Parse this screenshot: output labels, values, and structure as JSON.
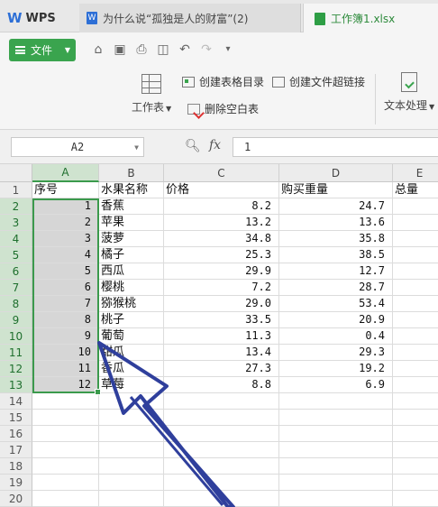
{
  "tabs": {
    "wps": "WPS",
    "doc": "为什么说“孤独是人的财富”(2)",
    "doc_badge": "W",
    "workbook": "工作簿1.xlsx"
  },
  "toolbar": {
    "file_label": "文件"
  },
  "ribbon": {
    "worksheet_label": "工作表",
    "create_toc": "创建表格目录",
    "create_hyperlink": "创建文件超链接",
    "delete_blank": "删除空白表",
    "text_process": "文本处理"
  },
  "formula_bar": {
    "name_box": "A2",
    "fx": "fx",
    "value": "1"
  },
  "columns": [
    "A",
    "B",
    "C",
    "D",
    "E"
  ],
  "rows": [
    "1",
    "2",
    "3",
    "4",
    "5",
    "6",
    "7",
    "8",
    "9",
    "10",
    "11",
    "12",
    "13",
    "14",
    "15",
    "16",
    "17",
    "18",
    "19",
    "20"
  ],
  "headers": {
    "a": "序号",
    "b": "水果名称",
    "c": "价格",
    "d": "购买重量",
    "e": "总量"
  },
  "data": [
    {
      "a": "1",
      "b": "香蕉",
      "c": "8.2",
      "d": "24.7"
    },
    {
      "a": "2",
      "b": "苹果",
      "c": "13.2",
      "d": "13.6"
    },
    {
      "a": "3",
      "b": "菠萝",
      "c": "34.8",
      "d": "35.8"
    },
    {
      "a": "4",
      "b": "橘子",
      "c": "25.3",
      "d": "38.5"
    },
    {
      "a": "5",
      "b": "西瓜",
      "c": "29.9",
      "d": "12.7"
    },
    {
      "a": "6",
      "b": "樱桃",
      "c": "7.2",
      "d": "28.7"
    },
    {
      "a": "7",
      "b": "猕猴桃",
      "c": "29.0",
      "d": "53.4"
    },
    {
      "a": "8",
      "b": "桃子",
      "c": "33.5",
      "d": "20.9"
    },
    {
      "a": "9",
      "b": "葡萄",
      "c": "11.3",
      "d": "0.4"
    },
    {
      "a": "10",
      "b": "甜瓜",
      "c": "13.4",
      "d": "29.3"
    },
    {
      "a": "11",
      "b": "香瓜",
      "c": "27.3",
      "d": "19.2"
    },
    {
      "a": "12",
      "b": "草莓",
      "c": "8.8",
      "d": "6.9"
    }
  ],
  "colors": {
    "accent": "#3aa44e",
    "selection": "#3b9a4c",
    "arrow": "#2f3f9c"
  }
}
